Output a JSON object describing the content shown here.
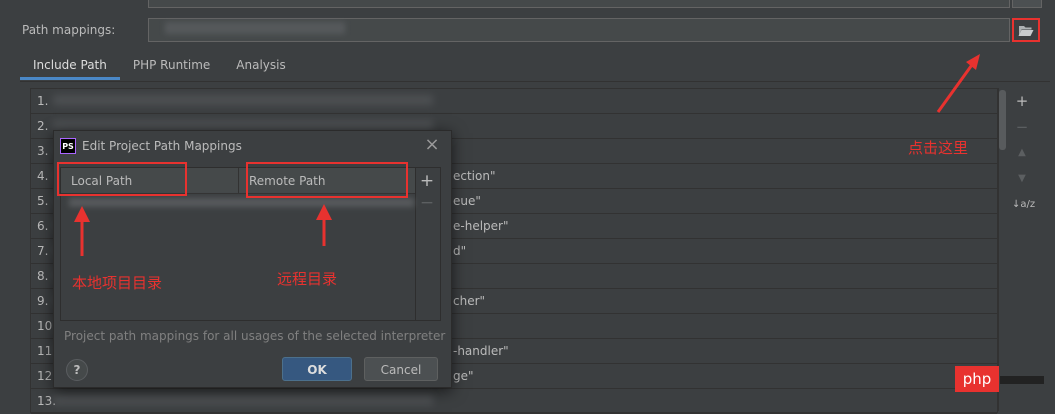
{
  "path_mappings": {
    "label": "Path mappings:",
    "browse_icon": "folder-open-icon"
  },
  "tabs": [
    {
      "label": "Include Path",
      "active": true
    },
    {
      "label": "PHP Runtime",
      "active": false
    },
    {
      "label": "Analysis",
      "active": false
    }
  ],
  "include_paths": [
    {
      "num": "1.",
      "tail": ""
    },
    {
      "num": "2.",
      "tail": ""
    },
    {
      "num": "3.",
      "tail": ""
    },
    {
      "num": "4.",
      "tail": "ection\""
    },
    {
      "num": "5.",
      "tail": "eue\""
    },
    {
      "num": "6.",
      "tail": "e-helper\""
    },
    {
      "num": "7.",
      "tail": "d\""
    },
    {
      "num": "8.",
      "tail": ""
    },
    {
      "num": "9.",
      "tail": "cher\""
    },
    {
      "num": "10",
      "tail": ""
    },
    {
      "num": "11",
      "tail": "-handler\""
    },
    {
      "num": "12",
      "tail": "ge\""
    },
    {
      "num": "13.",
      "tail": ""
    }
  ],
  "side_tools": {
    "add": "+",
    "remove": "−",
    "up": "▲",
    "down": "▼",
    "sort": "↓a/z"
  },
  "annotations": {
    "click_here": "点击这里",
    "local_dir": "本地项目目录",
    "remote_dir": "远程目录"
  },
  "dialog": {
    "title": "Edit Project Path Mappings",
    "app_icon": "PS",
    "col_local": "Local Path",
    "col_remote": "Remote Path",
    "add": "+",
    "remove": "−",
    "hint": "Project path mappings for all usages of the selected interpreter",
    "help": "?",
    "ok": "OK",
    "cancel": "Cancel"
  },
  "watermark": {
    "text": "php"
  },
  "colors": {
    "background": "#3c3f41",
    "accent": "#4a88c7",
    "annotation": "#e8322f",
    "ok_button": "#365880"
  }
}
